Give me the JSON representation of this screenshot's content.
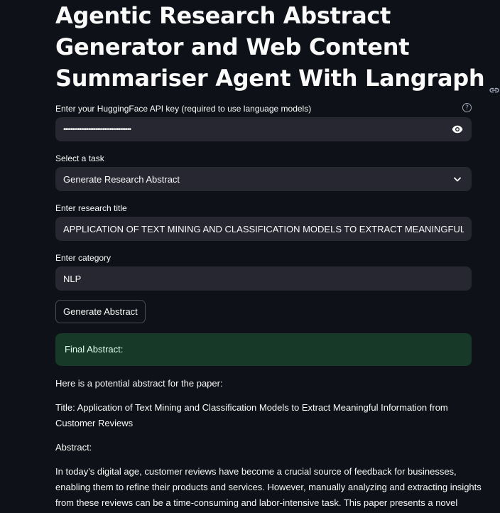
{
  "page": {
    "title_lines": [
      "Agentic Research Abstract",
      "Generator and Web Content",
      "Summariser Agent With Langraph"
    ],
    "anchor_icon": "link-icon"
  },
  "form": {
    "api_key": {
      "label": "Enter your HuggingFace API key (required to use language models)",
      "value": "••••••••••••••••••••••••••••••••••••••",
      "help_icon": "help-circle-icon",
      "toggle_icon": "eye-icon"
    },
    "task": {
      "label": "Select a task",
      "selected": "Generate Research Abstract",
      "icon": "chevron-down-icon"
    },
    "research_title": {
      "label": "Enter research title",
      "value": "APPLICATION OF TEXT MINING AND CLASSIFICATION MODELS TO EXTRACT MEANINGFUL INFORMATION"
    },
    "category": {
      "label": "Enter category",
      "value": "NLP"
    },
    "submit_label": "Generate Abstract"
  },
  "result": {
    "alert_text": "Final Abstract:",
    "intro": "Here is a potential abstract for the paper:",
    "title_line_1": "Title: Application of Text Mining and Classification Models to Extract Meaningful Information from",
    "title_line_2": "Customer Reviews",
    "abstract_heading": "Abstract:",
    "body_line_1": "In today's digital age, customer reviews have become a crucial source of feedback for businesses,",
    "body_line_2": "enabling them to refine their products and services. However, manually analyzing and extracting insights",
    "body_line_3": "from these reviews can be a time-consuming and labor-intensive task. This paper presents a novel"
  },
  "colors": {
    "background": "#0e1117",
    "input_bg": "#262730",
    "success_bg": "#173928",
    "success_text": "#dffde9",
    "text": "#fafafa"
  }
}
